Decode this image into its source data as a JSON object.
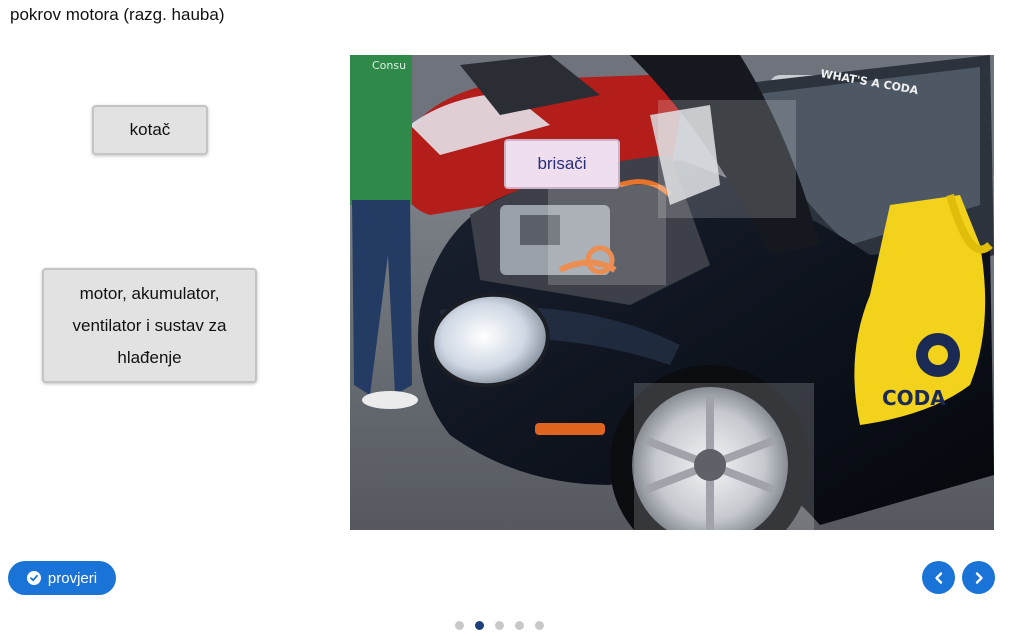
{
  "header": {
    "title": "pokrov motora (razg. hauba)"
  },
  "drag_items": [
    {
      "label": "kotač"
    },
    {
      "label": "motor, akumulator, ventilator i sustav za hlađenje"
    }
  ],
  "placed_item": {
    "label": "brisači"
  },
  "image_text": {
    "banner": "WHAT'S A CODA",
    "bag_logo": "CODA",
    "shirt_text": "Consu"
  },
  "actions": {
    "check_label": "provjeri",
    "check_icon": "check-circle-icon",
    "prev_icon": "chevron-left-icon",
    "next_icon": "chevron-right-icon"
  },
  "pagination": {
    "total": 5,
    "active_index": 2
  },
  "colors": {
    "accent": "#1a73d6",
    "active_dot": "#1f3e7a",
    "dot": "#c8c8c8",
    "placed_bg": "#efdfee"
  }
}
